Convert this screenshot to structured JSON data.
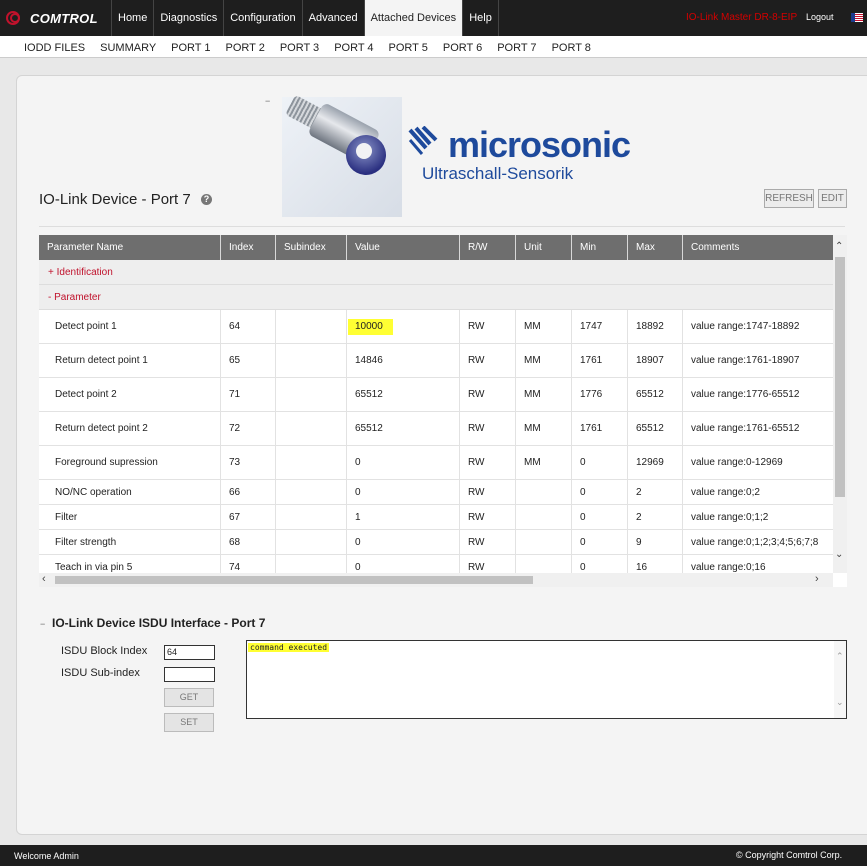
{
  "brand": {
    "name": "COMTROL"
  },
  "nav": {
    "items": [
      "Home",
      "Diagnostics",
      "Configuration",
      "Advanced",
      "Attached Devices",
      "Help"
    ],
    "active": "Attached Devices",
    "device_name": "IO-Link Master DR-8-EIP",
    "logout": "Logout"
  },
  "subnav": {
    "items": [
      "IODD FILES",
      "SUMMARY",
      "PORT 1",
      "PORT 2",
      "PORT 3",
      "PORT 4",
      "PORT 5",
      "PORT 6",
      "PORT 7",
      "PORT 8"
    ]
  },
  "vendor_logo": {
    "name": "microsonic",
    "tagline": "Ultraschall-Sensorik"
  },
  "page": {
    "title": "IO-Link Device - Port 7",
    "refresh_label": "REFRESH",
    "edit_label": "EDIT"
  },
  "table": {
    "headers": [
      "Parameter Name",
      "Index",
      "Subindex",
      "Value",
      "R/W",
      "Unit",
      "Min",
      "Max",
      "Comments"
    ],
    "groups": {
      "identification": "+ Identification",
      "parameter": "- Parameter"
    },
    "rows": [
      [
        "Detect point 1",
        "64",
        "",
        "10000",
        "RW",
        "MM",
        "1747",
        "18892",
        "value range:1747-18892"
      ],
      [
        "Return detect point 1",
        "65",
        "",
        "14846",
        "RW",
        "MM",
        "1761",
        "18907",
        "value range:1761-18907"
      ],
      [
        "Detect point 2",
        "71",
        "",
        "65512",
        "RW",
        "MM",
        "1776",
        "65512",
        "value range:1776-65512"
      ],
      [
        "Return detect point 2",
        "72",
        "",
        "65512",
        "RW",
        "MM",
        "1761",
        "65512",
        "value range:1761-65512"
      ],
      [
        "Foreground supression",
        "73",
        "",
        "0",
        "RW",
        "MM",
        "0",
        "12969",
        "value range:0-12969"
      ],
      [
        "NO/NC operation",
        "66",
        "",
        "0",
        "RW",
        "",
        "0",
        "2",
        "value range:0;2"
      ],
      [
        "Filter",
        "67",
        "",
        "1",
        "RW",
        "",
        "0",
        "2",
        "value range:0;1;2"
      ],
      [
        "Filter strength",
        "68",
        "",
        "0",
        "RW",
        "",
        "0",
        "9",
        "value range:0;1;2;3;4;5;6;7;8"
      ],
      [
        "Teach in via pin 5",
        "74",
        "",
        "0",
        "RW",
        "",
        "0",
        "16",
        "value range:0;16"
      ]
    ]
  },
  "isdu": {
    "title": "IO-Link Device ISDU Interface - Port 7",
    "block_index_label": "ISDU Block Index",
    "block_index_value": "64",
    "sub_index_label": "ISDU Sub-index",
    "sub_index_value": "",
    "get_label": "GET",
    "set_label": "SET",
    "result": "command executed"
  },
  "footer": {
    "welcome": "Welcome Admin",
    "copyright": "© Copyright Comtrol Corp."
  },
  "colors": {
    "accent_red": "#c0122c",
    "highlight": "#ffff33",
    "header_gray": "#6e6e6e",
    "logo_blue": "#1e4a9c"
  }
}
